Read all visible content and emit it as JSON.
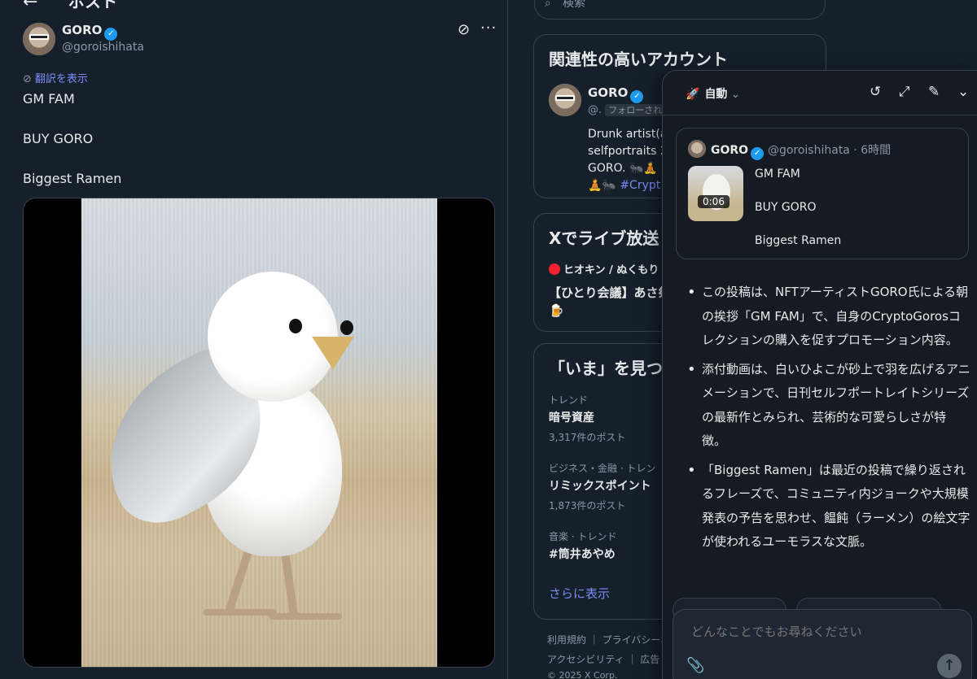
{
  "header": {
    "title": "ポスト"
  },
  "post": {
    "author_name": "GORO",
    "author_handle": "@goroishihata",
    "translate_label": "翻訳を表示",
    "lines": [
      "GM FAM",
      "BUY GORO",
      "Biggest Ramen"
    ]
  },
  "search": {
    "placeholder": "検索"
  },
  "related": {
    "title": "関連性の高いアカウント",
    "name": "GORO",
    "handle": "@.",
    "follows_badge": "フォローされ",
    "bio_lines": [
      "Drunk artist(a",
      "selfportraits 2",
      "GORO. 🐜🧘"
    ],
    "bio_tag_prefix": "🧘🐜 ",
    "bio_tag": "#Crypt"
  },
  "live": {
    "title": "Xでライブ放送",
    "user": "ヒオキン / ぬくもり",
    "stream_title": "【ひとり会議】あさ祭🍺"
  },
  "trends": {
    "title": "「いま」を見つ",
    "items": [
      {
        "meta": "トレンド",
        "name": "暗号資産",
        "count": "3,317件のポスト"
      },
      {
        "meta": "ビジネス・金融 · トレン",
        "name": "リミックスポイント",
        "count": "1,873件のポスト"
      },
      {
        "meta": "音楽 · トレンド",
        "name": "#筒井あやめ",
        "count": ""
      }
    ],
    "show_more": "さらに表示"
  },
  "footer": {
    "line1": "利用規約 ｜ プライバシーポ",
    "line2": "アクセシビリティ ｜ 広告",
    "copyright": "© 2025 X Corp."
  },
  "grok": {
    "mode": "自動",
    "quote": {
      "name": "GORO",
      "meta": "@goroishihata · 6時間",
      "duration": "0:06",
      "lines": [
        "GM FAM",
        "BUY GORO",
        "Biggest Ramen"
      ]
    },
    "summary": [
      "この投稿は、NFTアーティストGORO氏による朝の挨拶「GM FAM」で、自身のCryptoGorosコレクションの購入を促すプロモーション内容。",
      "添付動画は、白いひよこが砂上で羽を広げるアニメーションで、日刊セルフポートレイトシリーズの最新作とみられ、芸術的な可愛らしさが特徴。",
      "「Biggest Ramen」は最近の投稿で繰り返されるフレーズで、コミュニティ内ジョークや大規模発表の予告を思わせ、饂飩（ラーメン）の絵文字が使われるユーモラスな文脈。"
    ],
    "composer_placeholder": "どんなことでもお尋ねください"
  },
  "colors": {
    "background": "#15202b",
    "accent": "#1d9bf0",
    "link": "#7c8cf8",
    "muted": "#8b98a5"
  }
}
